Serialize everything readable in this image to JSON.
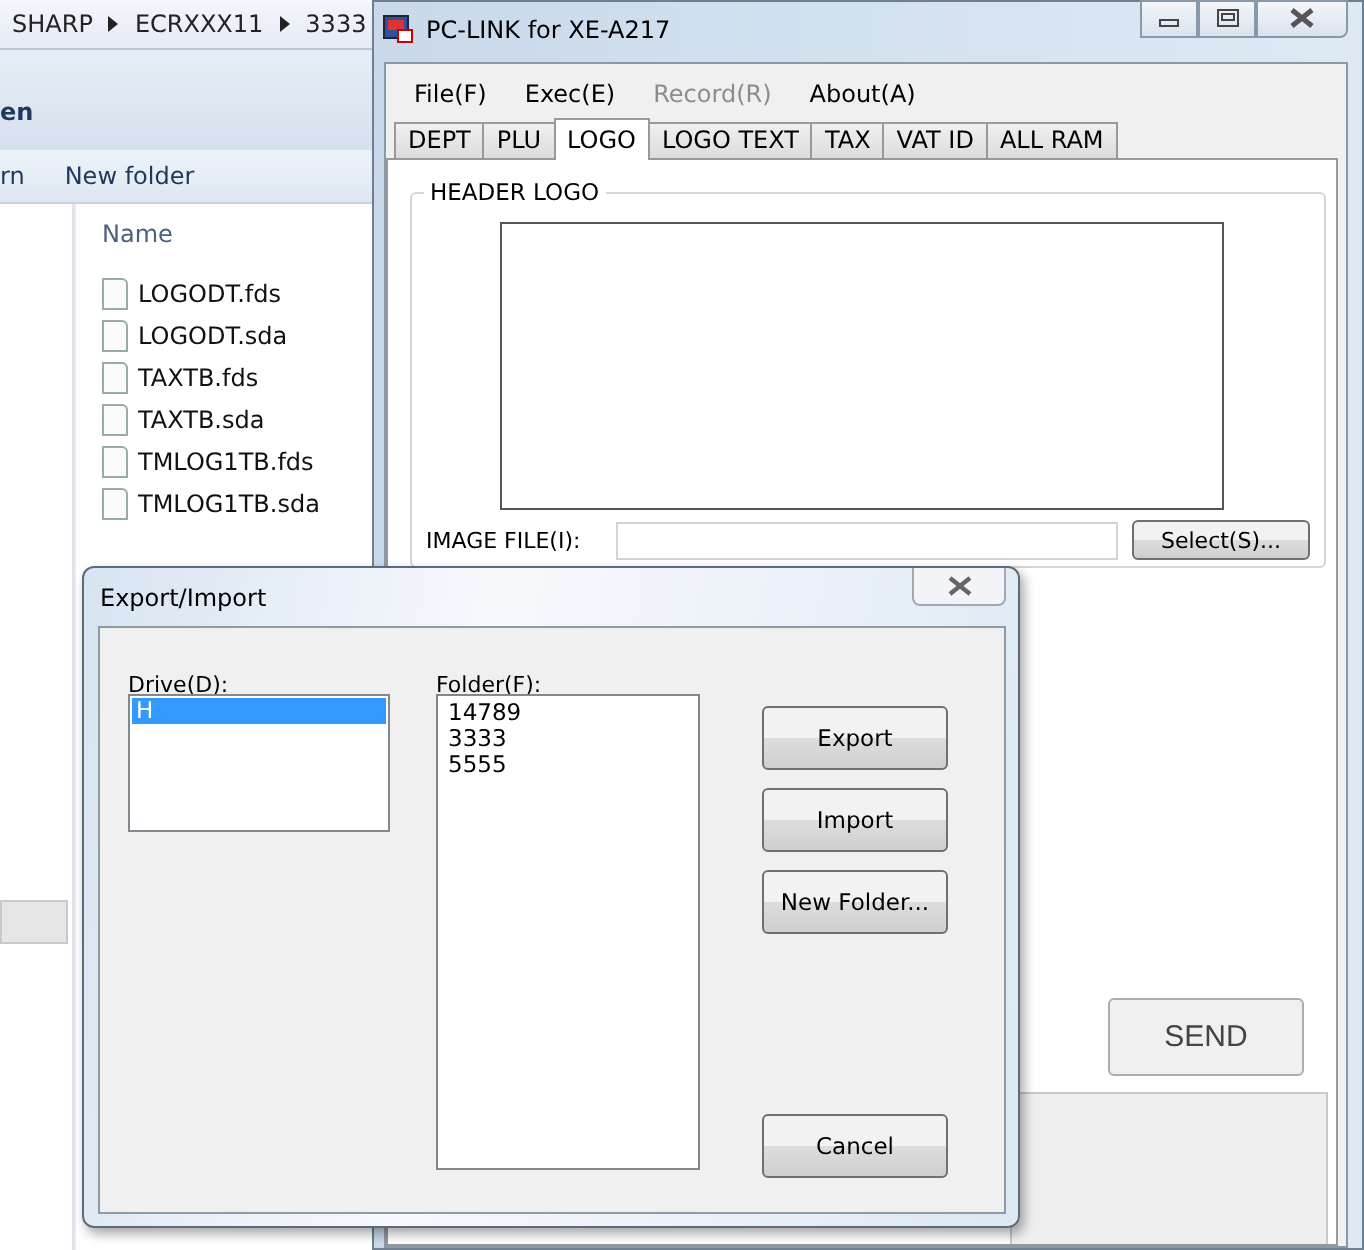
{
  "explorer": {
    "breadcrumb": [
      "SHARP",
      "ECRXXX11",
      "3333"
    ],
    "toolbar_row_1": "en",
    "toolbar_row_2": [
      "rn",
      "New folder"
    ],
    "column": "Name",
    "files": [
      "LOGODT.fds",
      "LOGODT.sda",
      "TAXTB.fds",
      "TAXTB.sda",
      "TMLOG1TB.fds",
      "TMLOG1TB.sda"
    ]
  },
  "pclink": {
    "title": "PC-LINK for XE-A217",
    "menu": [
      {
        "label": "File(F)",
        "disabled": false
      },
      {
        "label": "Exec(E)",
        "disabled": false
      },
      {
        "label": "Record(R)",
        "disabled": true
      },
      {
        "label": "About(A)",
        "disabled": false
      }
    ],
    "tabs": [
      {
        "label": "DEPT",
        "selected": false
      },
      {
        "label": "PLU",
        "selected": false
      },
      {
        "label": "LOGO",
        "selected": true
      },
      {
        "label": "LOGO TEXT",
        "selected": false
      },
      {
        "label": "TAX",
        "selected": false
      },
      {
        "label": "VAT ID",
        "selected": false
      },
      {
        "label": "ALL RAM",
        "selected": false
      }
    ],
    "group": "HEADER LOGO",
    "image_file_label": "IMAGE FILE(I):",
    "select_button": "Select(S)...",
    "send_button": "SEND"
  },
  "dialog": {
    "title": "Export/Import",
    "drive_label": "Drive(D):",
    "drives": [
      {
        "label": "H",
        "selected": true
      }
    ],
    "folder_label": "Folder(F):",
    "folders": [
      {
        "label": "14789",
        "selected": false
      },
      {
        "label": "3333",
        "selected": false
      },
      {
        "label": "5555",
        "selected": false
      }
    ],
    "buttons": [
      "Export",
      "Import",
      "New Folder..."
    ],
    "cancel_button": "Cancel"
  }
}
